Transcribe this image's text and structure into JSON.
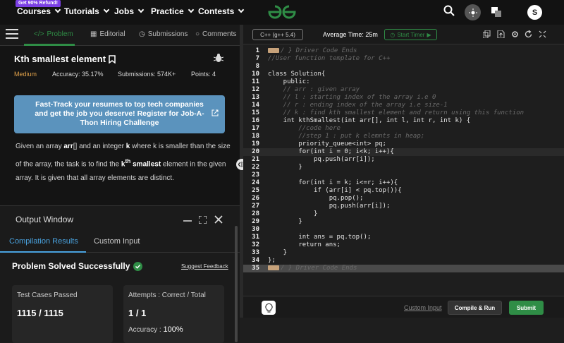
{
  "topnav": {
    "promo": "Get 90% Refund!",
    "items": [
      "Courses",
      "Tutorials",
      "Jobs",
      "Practice",
      "Contests"
    ],
    "avatar_initial": "S"
  },
  "tabs": {
    "problem": "Problem",
    "editorial": "Editorial",
    "submissions": "Submissions",
    "comments": "Comments"
  },
  "problem": {
    "title": "Kth smallest element",
    "difficulty": "Medium",
    "accuracy": "Accuracy: 35.17%",
    "submissions": "Submissions: 574K+",
    "points": "Points: 4",
    "banner": "Fast-Track your resumes to top tech companies and get the job you deserve! Register for Job-A-Thon Hiring Challenge",
    "desc_1": "Given an array ",
    "desc_arr": "arr",
    "desc_2": "[] and an integer ",
    "desc_k": "k",
    "desc_3": " where k is smaller than the size of the array, the task is to find the  ",
    "desc_kth": "k",
    "desc_th": "th",
    "desc_smallest": " smallest",
    "desc_4": " element in the given array. It is given that all array elements are distinct."
  },
  "output": {
    "title": "Output Window",
    "tab_results": "Compilation Results",
    "tab_custom": "Custom Input",
    "status": "Problem Solved Successfully",
    "feedback": "Suggest Feedback",
    "tests_label": "Test Cases Passed",
    "tests_value": "1115 / 1115",
    "attempts_label": "Attempts : Correct / Total",
    "attempts_value": "1 / 1",
    "accuracy_label": "Accuracy : ",
    "accuracy_value": "100%"
  },
  "editor": {
    "language": "C++ (g++ 5.4)",
    "avg_time": "Average Time: 25m",
    "timer": "Start Timer",
    "custom_input": "Custom Input",
    "compile": "Compile & Run",
    "submit": "Submit",
    "lines": [
      {
        "n": "1",
        "text": "/ } Driver Code Ends",
        "type": "cmt",
        "tag": true
      },
      {
        "n": "7",
        "text": "//User function template for C++",
        "type": "cmt"
      },
      {
        "n": "8",
        "text": "",
        "type": ""
      },
      {
        "n": "10",
        "text": "class Solution{",
        "type": ""
      },
      {
        "n": "11",
        "text": "    public:",
        "type": ""
      },
      {
        "n": "12",
        "text": "    // arr : given array",
        "type": "cmt"
      },
      {
        "n": "13",
        "text": "    // l : starting index of the array i.e 0",
        "type": "cmt"
      },
      {
        "n": "14",
        "text": "    // r : ending index of the array i.e size-1",
        "type": "cmt"
      },
      {
        "n": "15",
        "text": "    // k : find kth smallest element and return using this function",
        "type": "cmt"
      },
      {
        "n": "16",
        "text": "    int kthSmallest(int arr[], int l, int r, int k) {",
        "type": ""
      },
      {
        "n": "17",
        "text": "        //code here",
        "type": "cmt"
      },
      {
        "n": "18",
        "text": "        //step 1 : put k elemnts in heap;",
        "type": "cmt"
      },
      {
        "n": "19",
        "text": "        priority_queue<int> pq;",
        "type": ""
      },
      {
        "n": "20",
        "text": "        for(int i = 0; i<k; i++){",
        "type": "active"
      },
      {
        "n": "21",
        "text": "            pq.push(arr[i]);",
        "type": ""
      },
      {
        "n": "22",
        "text": "        }",
        "type": ""
      },
      {
        "n": "23",
        "text": "",
        "type": ""
      },
      {
        "n": "24",
        "text": "        for(int i = k; i<=r; i++){",
        "type": ""
      },
      {
        "n": "25",
        "text": "            if (arr[i] < pq.top()){",
        "type": ""
      },
      {
        "n": "26",
        "text": "                pq.pop();",
        "type": ""
      },
      {
        "n": "27",
        "text": "                pq.push(arr[i]);",
        "type": ""
      },
      {
        "n": "28",
        "text": "            }",
        "type": ""
      },
      {
        "n": "29",
        "text": "        }",
        "type": ""
      },
      {
        "n": "30",
        "text": "",
        "type": ""
      },
      {
        "n": "31",
        "text": "        int ans = pq.top();",
        "type": ""
      },
      {
        "n": "32",
        "text": "        return ans;",
        "type": ""
      },
      {
        "n": "33",
        "text": "    }",
        "type": ""
      },
      {
        "n": "34",
        "text": "};",
        "type": ""
      },
      {
        "n": "35",
        "text": "/ } Driver Code Ends",
        "type": "cmt hl",
        "tag": true
      }
    ]
  },
  "colors": {
    "accent": "#2f8d46",
    "banner": "#5b93bd",
    "link": "#4aa3e0"
  }
}
